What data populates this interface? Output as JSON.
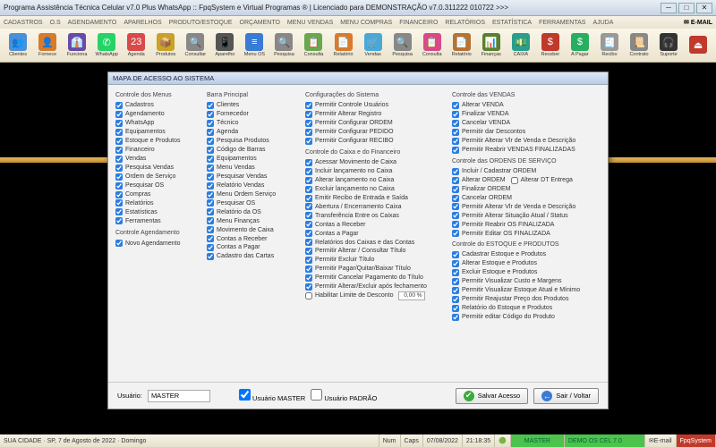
{
  "window": {
    "title": "Programa Assistência Técnica Celular v7.0 Plus WhatsApp :: FpqSystem e Virtual Programas ® | Licenciado para  DEMONSTRAÇÃO v7.0.311222 010722 >>>"
  },
  "menu": {
    "items": [
      "CADASTROS",
      "O.S",
      "AGENDAMENTO",
      "APARELHOS",
      "PRODUTO/ESTOQUE",
      "ORÇAMENTO",
      "MENU VENDAS",
      "MENU COMPRAS",
      "FINANCEIRO",
      "RELATÓRIOS",
      "ESTATÍSTICA",
      "FERRAMENTAS",
      "AJUDA"
    ],
    "email": "E-MAIL"
  },
  "toolbar": [
    {
      "label": "Clientes",
      "color": "#4a90d9",
      "glyph": "👥"
    },
    {
      "label": "Fornece",
      "color": "#d97b2a",
      "glyph": "👤"
    },
    {
      "label": "Funciona",
      "color": "#6a4aa8",
      "glyph": "👔"
    },
    {
      "label": "WhatsApp",
      "color": "#25d366",
      "glyph": "✆"
    },
    {
      "label": "Agenda",
      "color": "#d94a4a",
      "glyph": "23"
    },
    {
      "label": "Produtos",
      "color": "#c9a227",
      "glyph": "📦"
    },
    {
      "label": "Consultar",
      "color": "#888",
      "glyph": "🔍"
    },
    {
      "label": "Aparelho",
      "color": "#555",
      "glyph": "📱"
    },
    {
      "label": "Menu OS",
      "color": "#3a7bd5",
      "glyph": "≡"
    },
    {
      "label": "Pesquisa",
      "color": "#888",
      "glyph": "🔍"
    },
    {
      "label": "Consulta",
      "color": "#6aa84f",
      "glyph": "📋"
    },
    {
      "label": "Relatório",
      "color": "#d97b2a",
      "glyph": "📄"
    },
    {
      "label": "Vendas",
      "color": "#4aa8d9",
      "glyph": "🛒"
    },
    {
      "label": "Pesquisa",
      "color": "#888",
      "glyph": "🔍"
    },
    {
      "label": "Consulta",
      "color": "#d94a8a",
      "glyph": "📋"
    },
    {
      "label": "Relatório",
      "color": "#b87333",
      "glyph": "📄"
    },
    {
      "label": "Finanças",
      "color": "#5a8030",
      "glyph": "📊"
    },
    {
      "label": "CAIXA",
      "color": "#2a9d8f",
      "glyph": "💵"
    },
    {
      "label": "Receber",
      "color": "#c0392b",
      "glyph": "$"
    },
    {
      "label": "A Pagar",
      "color": "#27ae60",
      "glyph": "$"
    },
    {
      "label": "Recibo",
      "color": "#999",
      "glyph": "🧾"
    },
    {
      "label": "Contrato",
      "color": "#888",
      "glyph": "📜"
    },
    {
      "label": "Suporte",
      "color": "#333",
      "glyph": "🎧"
    },
    {
      "label": "",
      "color": "#c0392b",
      "glyph": "⏏"
    }
  ],
  "dialog": {
    "title": "MAPA DE ACESSO AO SISTEMA",
    "col1": {
      "h1": "Controle dos Menus",
      "g1": [
        "Cadastros",
        "Agendamento",
        "WhatsApp",
        "Equipamentos",
        "Estoque e Produtos",
        "Financeiro",
        "Vendas",
        "Pesquisa Vendas",
        "Ordem de Serviço",
        "Pesquisar OS",
        "Compras",
        "Relatórios",
        "Estatísticas",
        "Ferramentas"
      ],
      "h2": "Controle Agendamento",
      "g2": [
        "Novo Agendamento"
      ]
    },
    "col2": {
      "h1": "Barra Principal",
      "g1": [
        "Clientes",
        "Fornecedor",
        "Técnico",
        "Agenda",
        "Pesquisa Produtos",
        "Código de Barras",
        "Equipamentos",
        "Menu Vendas",
        "Pesquisar Vendas",
        "Relatório Vendas",
        "Menu Ordem Serviço",
        "Pesquisar OS",
        "Relatório da OS",
        "Menu Finanças",
        "Movimento de Caixa",
        "Contas a Receber",
        "Contas a Pagar",
        "Cadastro das Cartas"
      ]
    },
    "col3": {
      "h1": "Configurações do Sistema",
      "g1": [
        "Permitir Controle Usuários",
        "Permitir Alterar Registro",
        "Permitir Configurar ORDEM",
        "Permitir Configurar PEDIDO",
        "Permitir Configurar RECIBO"
      ],
      "h2": "Controle do Caixa e do Financeiro",
      "g2": [
        "Acessar Movimento de Caixa",
        "Incluir lançamento no Caixa",
        "Alterar lançamento no Caixa",
        "Excluir lançamento no Caixa",
        "Emitir Recibo de Entrada e Saída",
        "Abertura / Encerramento Caixa",
        "Transferência Entre os Caixas",
        "Contas a Receber",
        "Contas a Pagar",
        "Relatórios dos Caixas e das Contas",
        "Permitir Alterar / Consultar Título",
        "Permitir Excluir Título",
        "Permitir Pagar/Quitar/Baixar Título",
        "Permitir Cancelar Pagamento do Título",
        "Permitir Alterar/Excluir após fechamento"
      ],
      "discount_label": "Habilitar Limite de Desconto",
      "discount_value": "0,00 %"
    },
    "col4": {
      "h1": "Controle das VENDAS",
      "g1": [
        "Alterar VENDA",
        "Finalizar VENDA",
        "Cancelar VENDA",
        "Permitir dar Descontos",
        "Permitir Alterar Vlr de Venda e Descrição",
        "Permitir Reabrir VENDAS FINALIZADAS"
      ],
      "h2": "Controle das ORDENS DE SERVIÇO",
      "g2a": "Incluir / Cadastrar ORDEM",
      "g2b": "Alterar ORDEM",
      "g2c": "Alterar DT Entrega",
      "g2rest": [
        "Finalizar ORDEM",
        "Cancelar ORDEM",
        "Permitir Alterar Vlr de Venda e Descrição",
        "Permitir Alterar Situação Atual / Status",
        "Permitir Reabrir OS FINALIZADA",
        "Permitir Editar OS FINALIZADA"
      ],
      "h3": "Controle do ESTOQUE e PRODUTOS",
      "g3": [
        "Cadastrar Estoque e Produtos",
        "Alterar Estoque e Produtos",
        "Excluir Estoque e Produtos",
        "Permitir Visualizar Custo e Margens",
        "Permitir Visualizar Estoque Atual e Mínimo",
        "Permitir Reajustar Preço dos Produtos",
        "Relatório do Estoque e Produtos",
        "Permitir editar Código do Produto"
      ]
    },
    "footer": {
      "user_label": "Usuário:",
      "user_value": "MASTER",
      "cb_master": "Usuário MASTER",
      "cb_padrao": "Usuário PADRÃO",
      "btn_save": "Salvar Acesso",
      "btn_back": "Sair / Voltar"
    }
  },
  "status": {
    "left": "SUA CIDADE · SP, 7 de Agosto de 2022 · Domingo",
    "num": "Num",
    "caps": "Caps",
    "date": "07/08/2022",
    "time": "21:18:35",
    "master": "MASTER",
    "demo": "DEMO OS CEL 7.0",
    "email": "E-mail",
    "fpq": "FpqSystem"
  }
}
